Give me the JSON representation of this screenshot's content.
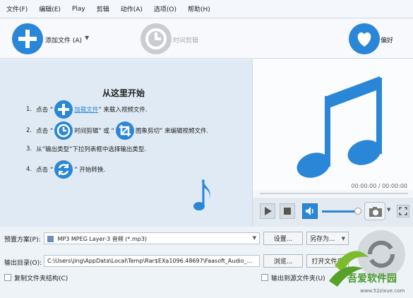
{
  "menu": [
    "文件(F)",
    "编辑(E)",
    "Play",
    "剪辑",
    "动作(A)",
    "选项(O)",
    "帮助(H)"
  ],
  "toolbar": {
    "add_file_label": "添加文件",
    "add_file_shortcut": "(A)",
    "time_clip_label": "时间剪辑",
    "favorite_label": "偏好"
  },
  "start": {
    "title": "从这里开始",
    "step1": {
      "num": "1.",
      "pre": "点击 “",
      "link": "加载文件",
      "post": "” 来载入视频文件."
    },
    "step2": {
      "num": "2.",
      "pre": "点击 “",
      "mid": "时间剪辑” 或 “",
      "post": "图象剪切” 来编辑视频文件."
    },
    "step3": {
      "num": "3.",
      "text": "从“输出类型”下拉列表框中选择输出类型."
    },
    "step4": {
      "num": "4.",
      "pre": "点击 “",
      "post": "” 开始转换."
    }
  },
  "preview": {
    "time": "00:00:00 / 00:00:00"
  },
  "form": {
    "preset_label": "预置方案(P):",
    "preset_value": "MP3 MPEG Layer-3 音频 (*.mp3)",
    "settings_button": "设置...",
    "save_as_button": "另存为...",
    "output_label": "输出目录(O):",
    "output_value": "C:\\Users\\jing\\AppData\\Local\\Temp\\Rar$EXa1096.48697\\Faasoft_Audio_...",
    "browse_button": "浏览...",
    "open_folder_button": "打开文件夹",
    "copy_structure_label": "复制文件夹结构(C)",
    "output_source_label": "输出到源文件夹(U)"
  },
  "watermark": {
    "text": "吾爱软件园",
    "url": "www.52zixue.com"
  },
  "colors": {
    "accent": "#2a86d6",
    "gray": "#c9ccd0"
  }
}
